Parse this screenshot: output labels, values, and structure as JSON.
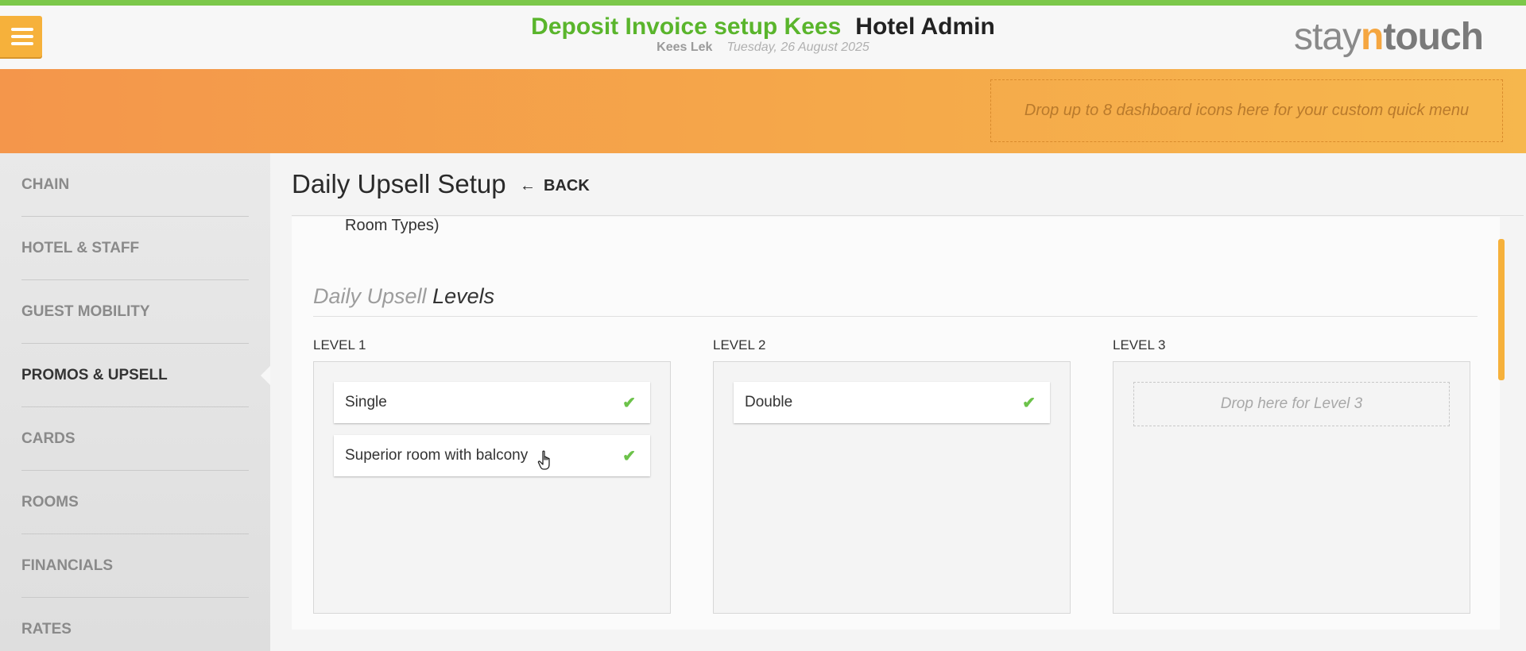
{
  "header": {
    "hotel_name": "Deposit Invoice setup Kees",
    "app_name": "Hotel Admin",
    "user": "Kees Lek",
    "date": "Tuesday, 26 August 2025",
    "logo": {
      "stay": "stay",
      "n": "n",
      "touch": "touch"
    },
    "menu_icon": "hamburger-icon"
  },
  "quick_menu": {
    "placeholder": "Drop up to 8 dashboard icons here for your custom quick menu"
  },
  "sidebar": {
    "items": [
      {
        "label": "CHAIN"
      },
      {
        "label": "HOTEL & STAFF"
      },
      {
        "label": "GUEST MOBILITY"
      },
      {
        "label": "PROMOS & UPSELL",
        "active": true
      },
      {
        "label": "CARDS"
      },
      {
        "label": "ROOMS"
      },
      {
        "label": "FINANCIALS"
      },
      {
        "label": "RATES"
      }
    ]
  },
  "main": {
    "title": "Daily Upsell Setup",
    "back_label": "BACK",
    "cut_text": "Room Types)",
    "section_title_light": "Daily Upsell",
    "section_title_dark": "Levels",
    "levels": [
      {
        "label": "LEVEL 1",
        "items": [
          "Single",
          "Superior room with balcony"
        ]
      },
      {
        "label": "LEVEL 2",
        "items": [
          "Double"
        ]
      },
      {
        "label": "LEVEL 3",
        "items": [],
        "drop_placeholder": "Drop here for Level 3"
      }
    ]
  },
  "colors": {
    "accent_green": "#5ab52c",
    "accent_orange": "#f6b13b",
    "check_green": "#6cc24a"
  }
}
